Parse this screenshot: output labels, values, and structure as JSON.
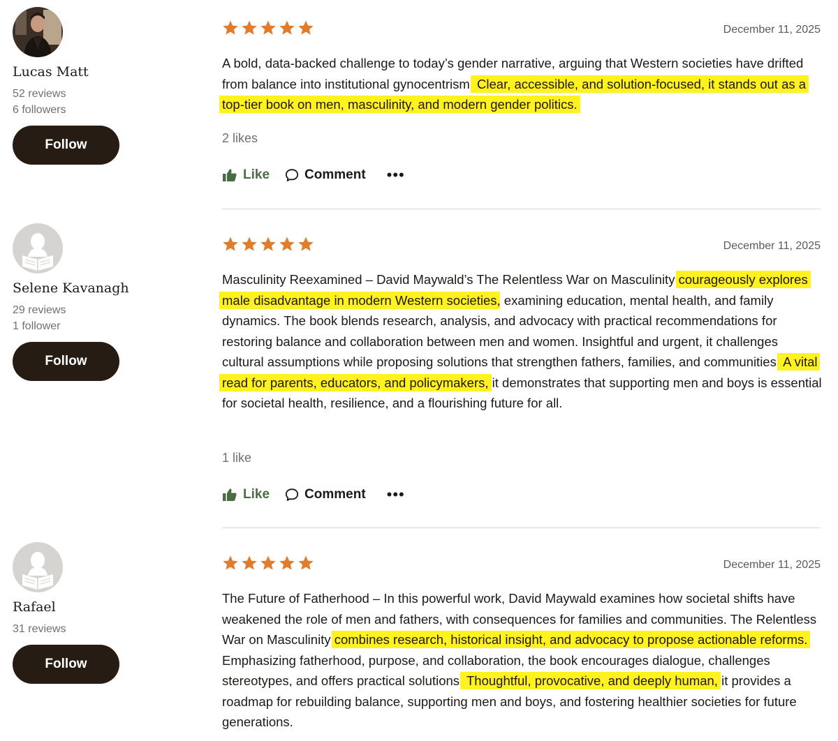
{
  "colors": {
    "star": "#e07c2c",
    "highlight": "#fff21f",
    "follow_bg": "#271c14",
    "like_green": "#4a6b44"
  },
  "icons": {
    "star": "star-icon",
    "like": "thumbs-up-icon",
    "comment": "comment-bubble-icon",
    "more": "more-horizontal-icon"
  },
  "actions": {
    "like_label": "Like",
    "comment_label": "Comment",
    "more_label": "•••"
  },
  "reviews": [
    {
      "reviewer": {
        "name": "Lucas Matt",
        "reviews": "52 reviews",
        "followers": "6 followers",
        "follow_label": "Follow",
        "avatar": "photo"
      },
      "rating": 5,
      "date": "December 11, 2025",
      "segments": [
        {
          "text": "A bold, data-backed challenge to today’s gender narrative, arguing that Western societies have drifted from balance into institutional gynocentrism.",
          "highlight": false
        },
        {
          "text": " Clear, accessible, and solution-focused, it stands out as a top-tier book on men, masculinity, and modern gender politics.",
          "highlight": true
        }
      ],
      "likes": "2 likes"
    },
    {
      "reviewer": {
        "name": "Selene Kavanagh",
        "reviews": "29 reviews",
        "followers": "1 follower",
        "follow_label": "Follow",
        "avatar": "default-silhouette"
      },
      "rating": 5,
      "date": "December 11, 2025",
      "segments": [
        {
          "text": "Masculinity Reexamined – David Maywald’s The Relentless War on Masculinity ",
          "highlight": false
        },
        {
          "text": "courageously explores male disadvantage in modern Western societies",
          "highlight": true
        },
        {
          "text": ", examining education, mental health, and family dynamics. The book blends research, analysis, and advocacy with practical recommendations for restoring balance and collaboration between men and women. Insightful and urgent, it challenges cultural assumptions while proposing solutions that strengthen fathers, families, and communities.",
          "highlight": false
        },
        {
          "text": " A vital read for parents, educators, and policymakers,",
          "highlight": true
        },
        {
          "text": " it demonstrates that supporting men and boys is essential for societal health, resilience, and a flourishing future for all.",
          "highlight": false
        }
      ],
      "likes": "1 like"
    },
    {
      "reviewer": {
        "name": "Rafael",
        "reviews": "31 reviews",
        "followers": "",
        "follow_label": "Follow",
        "avatar": "default-silhouette"
      },
      "rating": 5,
      "date": "December 11, 2025",
      "segments": [
        {
          "text": "The Future of Fatherhood – In this powerful work, David Maywald examines how societal shifts have weakened the role of men and fathers, with consequences for families and communities. The Relentless War on Masculinity ",
          "highlight": false
        },
        {
          "text": "combines research, historical insight, and advocacy to propose actionable reforms.",
          "highlight": true
        },
        {
          "text": " Emphasizing fatherhood, purpose, and collaboration, the book encourages dialogue, challenges stereotypes, and offers practical solutions.",
          "highlight": false
        },
        {
          "text": " Thoughtful, provocative, and deeply human,",
          "highlight": true
        },
        {
          "text": " it provides a roadmap for rebuilding balance, supporting men and boys, and fostering healthier societies for future generations.",
          "highlight": false
        }
      ],
      "likes": ""
    }
  ]
}
